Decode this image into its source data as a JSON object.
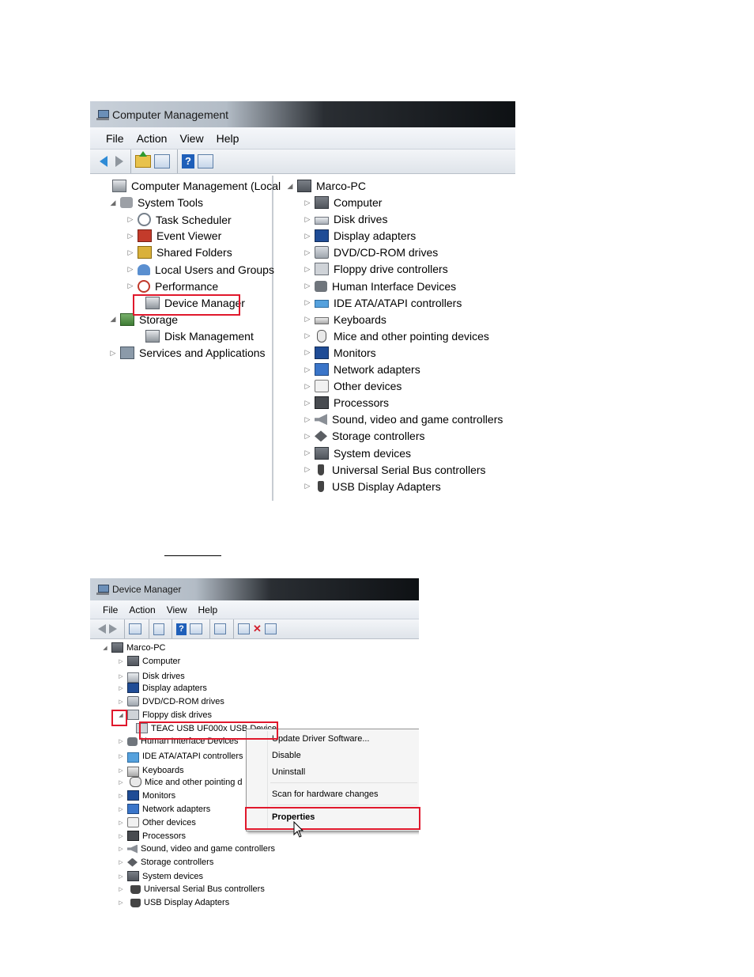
{
  "computer_management": {
    "title": "Computer Management",
    "menu": [
      "File",
      "Action",
      "View",
      "Help"
    ],
    "left_tree": [
      {
        "label": "Computer Management (Local",
        "icon": "computer-management-icon",
        "expander": ""
      },
      {
        "label": "System Tools",
        "icon": "tools-icon",
        "expander": "◢"
      },
      {
        "label": "Task Scheduler",
        "icon": "clock-icon",
        "expander": "▷"
      },
      {
        "label": "Event Viewer",
        "icon": "event-viewer-icon",
        "expander": "▷"
      },
      {
        "label": "Shared Folders",
        "icon": "shared-folders-icon",
        "expander": "▷"
      },
      {
        "label": "Local Users and Groups",
        "icon": "users-icon",
        "expander": "▷"
      },
      {
        "label": "Performance",
        "icon": "performance-icon",
        "expander": "▷"
      },
      {
        "label": "Device Manager",
        "icon": "device-manager-icon",
        "expander": ""
      },
      {
        "label": "Storage",
        "icon": "storage-icon",
        "expander": "◢"
      },
      {
        "label": "Disk Management",
        "icon": "disk-management-icon",
        "expander": ""
      },
      {
        "label": "Services and Applications",
        "icon": "services-icon",
        "expander": "▷"
      }
    ],
    "right_root": "Marco-PC",
    "right_tree": [
      "Computer",
      "Disk drives",
      "Display adapters",
      "DVD/CD-ROM drives",
      "Floppy drive controllers",
      "Human Interface Devices",
      "IDE ATA/ATAPI controllers",
      "Keyboards",
      "Mice and other pointing devices",
      "Monitors",
      "Network adapters",
      "Other devices",
      "Processors",
      "Sound, video and game controllers",
      "Storage controllers",
      "System devices",
      "Universal Serial Bus controllers",
      "USB Display Adapters"
    ]
  },
  "device_manager": {
    "title": "Device Manager",
    "menu": [
      "File",
      "Action",
      "View",
      "Help"
    ],
    "root": "Marco-PC",
    "tree": [
      "Computer",
      "Disk drives",
      "Display adapters",
      "DVD/CD-ROM drives",
      "Floppy disk drives",
      "TEAC USB UF000x USB Device",
      "Human Interface Devices",
      "IDE ATA/ATAPI controllers",
      "Keyboards",
      "Mice and other pointing d",
      "Monitors",
      "Network adapters",
      "Other devices",
      "Processors",
      "Sound, video and game controllers",
      "Storage controllers",
      "System devices",
      "Universal Serial Bus controllers",
      "USB Display Adapters"
    ],
    "context_menu": [
      "Update Driver Software...",
      "Disable",
      "Uninstall",
      "Scan for hardware changes",
      "Properties"
    ]
  },
  "colors": {
    "highlight": "#e0182c",
    "arrow": "#2e8bd6"
  }
}
